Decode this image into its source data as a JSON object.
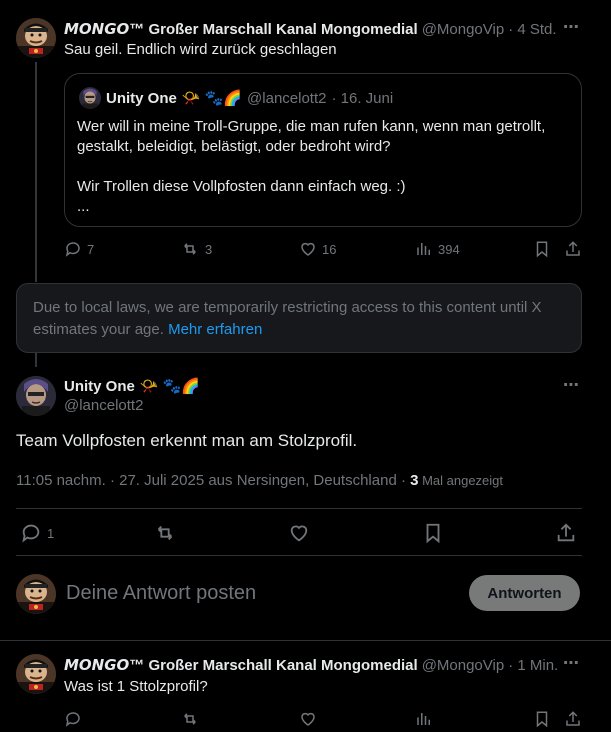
{
  "tweet1": {
    "name": "𝙈𝙊𝙉𝙂𝙊™ Großer Marschall Kanal Mongomedial",
    "handle": "@MongoVip",
    "time": "· 4 Std.",
    "text": "Sau geil. Endlich wird zurück geschlagen",
    "quote": {
      "name": "Unity One",
      "emojis": "📯 🐾🌈",
      "handle": "@lancelott2",
      "time": "· 16. Juni",
      "line1": "Wer will in meine Troll-Gruppe, die man rufen kann, wenn man getrollt,",
      "line2": "gestalkt, beleidigt, belästigt, oder bedroht wird?",
      "line3": "Wir Trollen diese Vollpfosten dann einfach weg. :)",
      "line4": "..."
    },
    "replies": "7",
    "reposts": "3",
    "likes": "16",
    "views": "394"
  },
  "notice": {
    "text1": "Due to local laws, we are temporarily restricting access to this content until X",
    "text2": "estimates your age.",
    "link": "Mehr erfahren"
  },
  "main_tweet": {
    "name": "Unity One",
    "emojis": "📯 🐾🌈",
    "handle": "@lancelott2",
    "text": "Team Vollpfosten erkennt man am Stolzprofil.",
    "meta": "11:05 nachm. · 27. Juli 2025 aus Nersingen, Deutschland · ",
    "views_count": "3",
    "views_label": " Mal angezeigt",
    "replies": "1"
  },
  "composer": {
    "placeholder": "Deine Antwort posten",
    "button": "Antworten"
  },
  "reply": {
    "name": "𝙈𝙊𝙉𝙂𝙊™ Großer Marschall Kanal Mongomedial",
    "handle": "@MongoVip",
    "time": "· 1 Min.",
    "text": "Was ist 1 Sttolzprofil?"
  },
  "more_icon": "⋯"
}
